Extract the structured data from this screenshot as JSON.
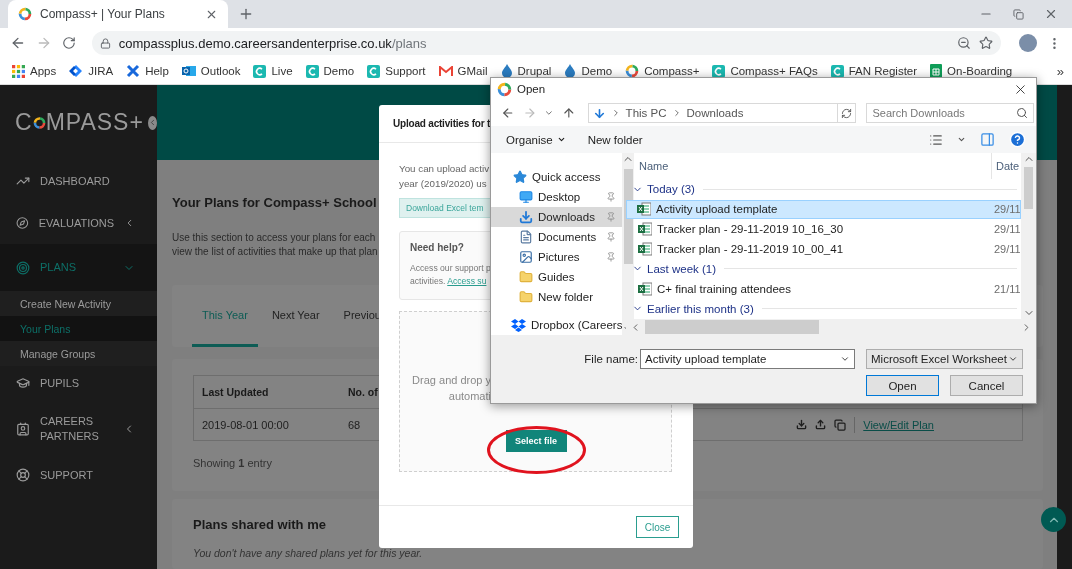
{
  "browser": {
    "tab_title": "Compass+ | Your Plans",
    "url_host": "compassplus.demo.careersandenterprise.co.uk",
    "url_path": "/plans",
    "bookmarks": [
      {
        "label": "Apps",
        "kind": "apps"
      },
      {
        "label": "JIRA",
        "kind": "jira"
      },
      {
        "label": "Help",
        "kind": "help"
      },
      {
        "label": "Outlook",
        "kind": "outlook"
      },
      {
        "label": "Live",
        "kind": "c"
      },
      {
        "label": "Demo",
        "kind": "c"
      },
      {
        "label": "Support",
        "kind": "c"
      },
      {
        "label": "GMail",
        "kind": "gmail"
      },
      {
        "label": "Drupal",
        "kind": "drop"
      },
      {
        "label": "Demo",
        "kind": "drop"
      },
      {
        "label": "Compass+",
        "kind": "ring"
      },
      {
        "label": "Compass+ FAQs",
        "kind": "c"
      },
      {
        "label": "FAN Register",
        "kind": "c"
      },
      {
        "label": "On-Boarding",
        "kind": "sheet"
      }
    ],
    "more": "»"
  },
  "sidebar": {
    "logo_start": "C",
    "logo_end": "MPASS+",
    "items": [
      {
        "label": "DASHBOARD",
        "kind": "dashboard",
        "selected": false
      },
      {
        "label": "EVALUATIONS",
        "kind": "evaluations",
        "selected": false,
        "expanded": false
      },
      {
        "label": "PLANS",
        "kind": "plans",
        "selected": true,
        "expanded": true,
        "children": [
          {
            "label": "Create New Activity",
            "selected": false
          },
          {
            "label": "Your Plans",
            "selected": true
          },
          {
            "label": "Manage Groups",
            "selected": false
          }
        ]
      },
      {
        "label": "PUPILS",
        "kind": "pupils",
        "selected": false
      },
      {
        "label": "CAREERS PARTNERS",
        "kind": "careers",
        "selected": false,
        "expanded": false
      },
      {
        "label": "SUPPORT",
        "kind": "support",
        "selected": false
      }
    ]
  },
  "page": {
    "title": "Your Plans for Compass+ School",
    "intro": [
      "Use this section to access your plans for each",
      "view the list of activities that make up that plan"
    ],
    "tabs": [
      {
        "label": "This Year",
        "selected": true
      },
      {
        "label": "Next Year",
        "selected": false
      },
      {
        "label": "Previou",
        "selected": false
      }
    ],
    "table": {
      "columns": [
        "Last Updated",
        "No. of"
      ],
      "rows": [
        {
          "cells": [
            "2019-08-01 00:00",
            "68"
          ],
          "link": "View/Edit Plan"
        }
      ]
    },
    "showing": "Showing **1** entry",
    "shared_title": "Plans shared with me",
    "shared_empty": "You don't have any shared plans yet for this year."
  },
  "modal": {
    "title": "Upload activities for t",
    "text": [
      "You can upload activ",
      "year (2019/2020) us"
    ],
    "download_button": "Download Excel tem",
    "help_title": "Need help?",
    "help_text": [
      "Access our support p",
      "activities. "
    ],
    "help_link": "Access su",
    "dropzone": [
      "Drag and drop y",
      "automati"
    ],
    "select_button": "Select file",
    "close_button": "Close"
  },
  "open_dialog": {
    "title": "Open",
    "path": [
      "This PC",
      "Downloads"
    ],
    "search_placeholder": "Search Downloads",
    "organise": "Organise",
    "new_folder": "New folder",
    "nav": [
      {
        "label": "Quick access",
        "kind": "star",
        "selected": false,
        "pinned": false
      },
      {
        "label": "Desktop",
        "kind": "desktop",
        "selected": false,
        "pinned": true
      },
      {
        "label": "Downloads",
        "kind": "downloads",
        "selected": true,
        "pinned": true
      },
      {
        "label": "Documents",
        "kind": "documents",
        "selected": false,
        "pinned": true
      },
      {
        "label": "Pictures",
        "kind": "pictures",
        "selected": false,
        "pinned": true
      },
      {
        "label": "Guides",
        "kind": "folder",
        "selected": false,
        "pinned": false
      },
      {
        "label": "New folder",
        "kind": "folder",
        "selected": false,
        "pinned": false
      },
      {
        "label": "Dropbox (Careers",
        "kind": "dropbox",
        "selected": false,
        "pinned": false
      }
    ],
    "columns": [
      "Name",
      "Date"
    ],
    "groups": [
      {
        "label": "Today (3)",
        "files": [
          {
            "name": "Activity upload template",
            "date": "29/11",
            "selected": true
          },
          {
            "name": "Tracker plan - 29-11-2019 10_16_30",
            "date": "29/11",
            "selected": false
          },
          {
            "name": "Tracker plan - 29-11-2019 10_00_41",
            "date": "29/11",
            "selected": false
          }
        ]
      },
      {
        "label": "Last week (1)",
        "files": [
          {
            "name": "C+ final training attendees",
            "date": "21/11",
            "selected": false
          }
        ]
      },
      {
        "label": "Earlier this month (3)"
      }
    ],
    "file_name_label": "File name:",
    "file_name": "Activity upload template",
    "file_type": "Microsoft Excel Worksheet",
    "buttons": [
      "Open",
      "Cancel"
    ]
  }
}
